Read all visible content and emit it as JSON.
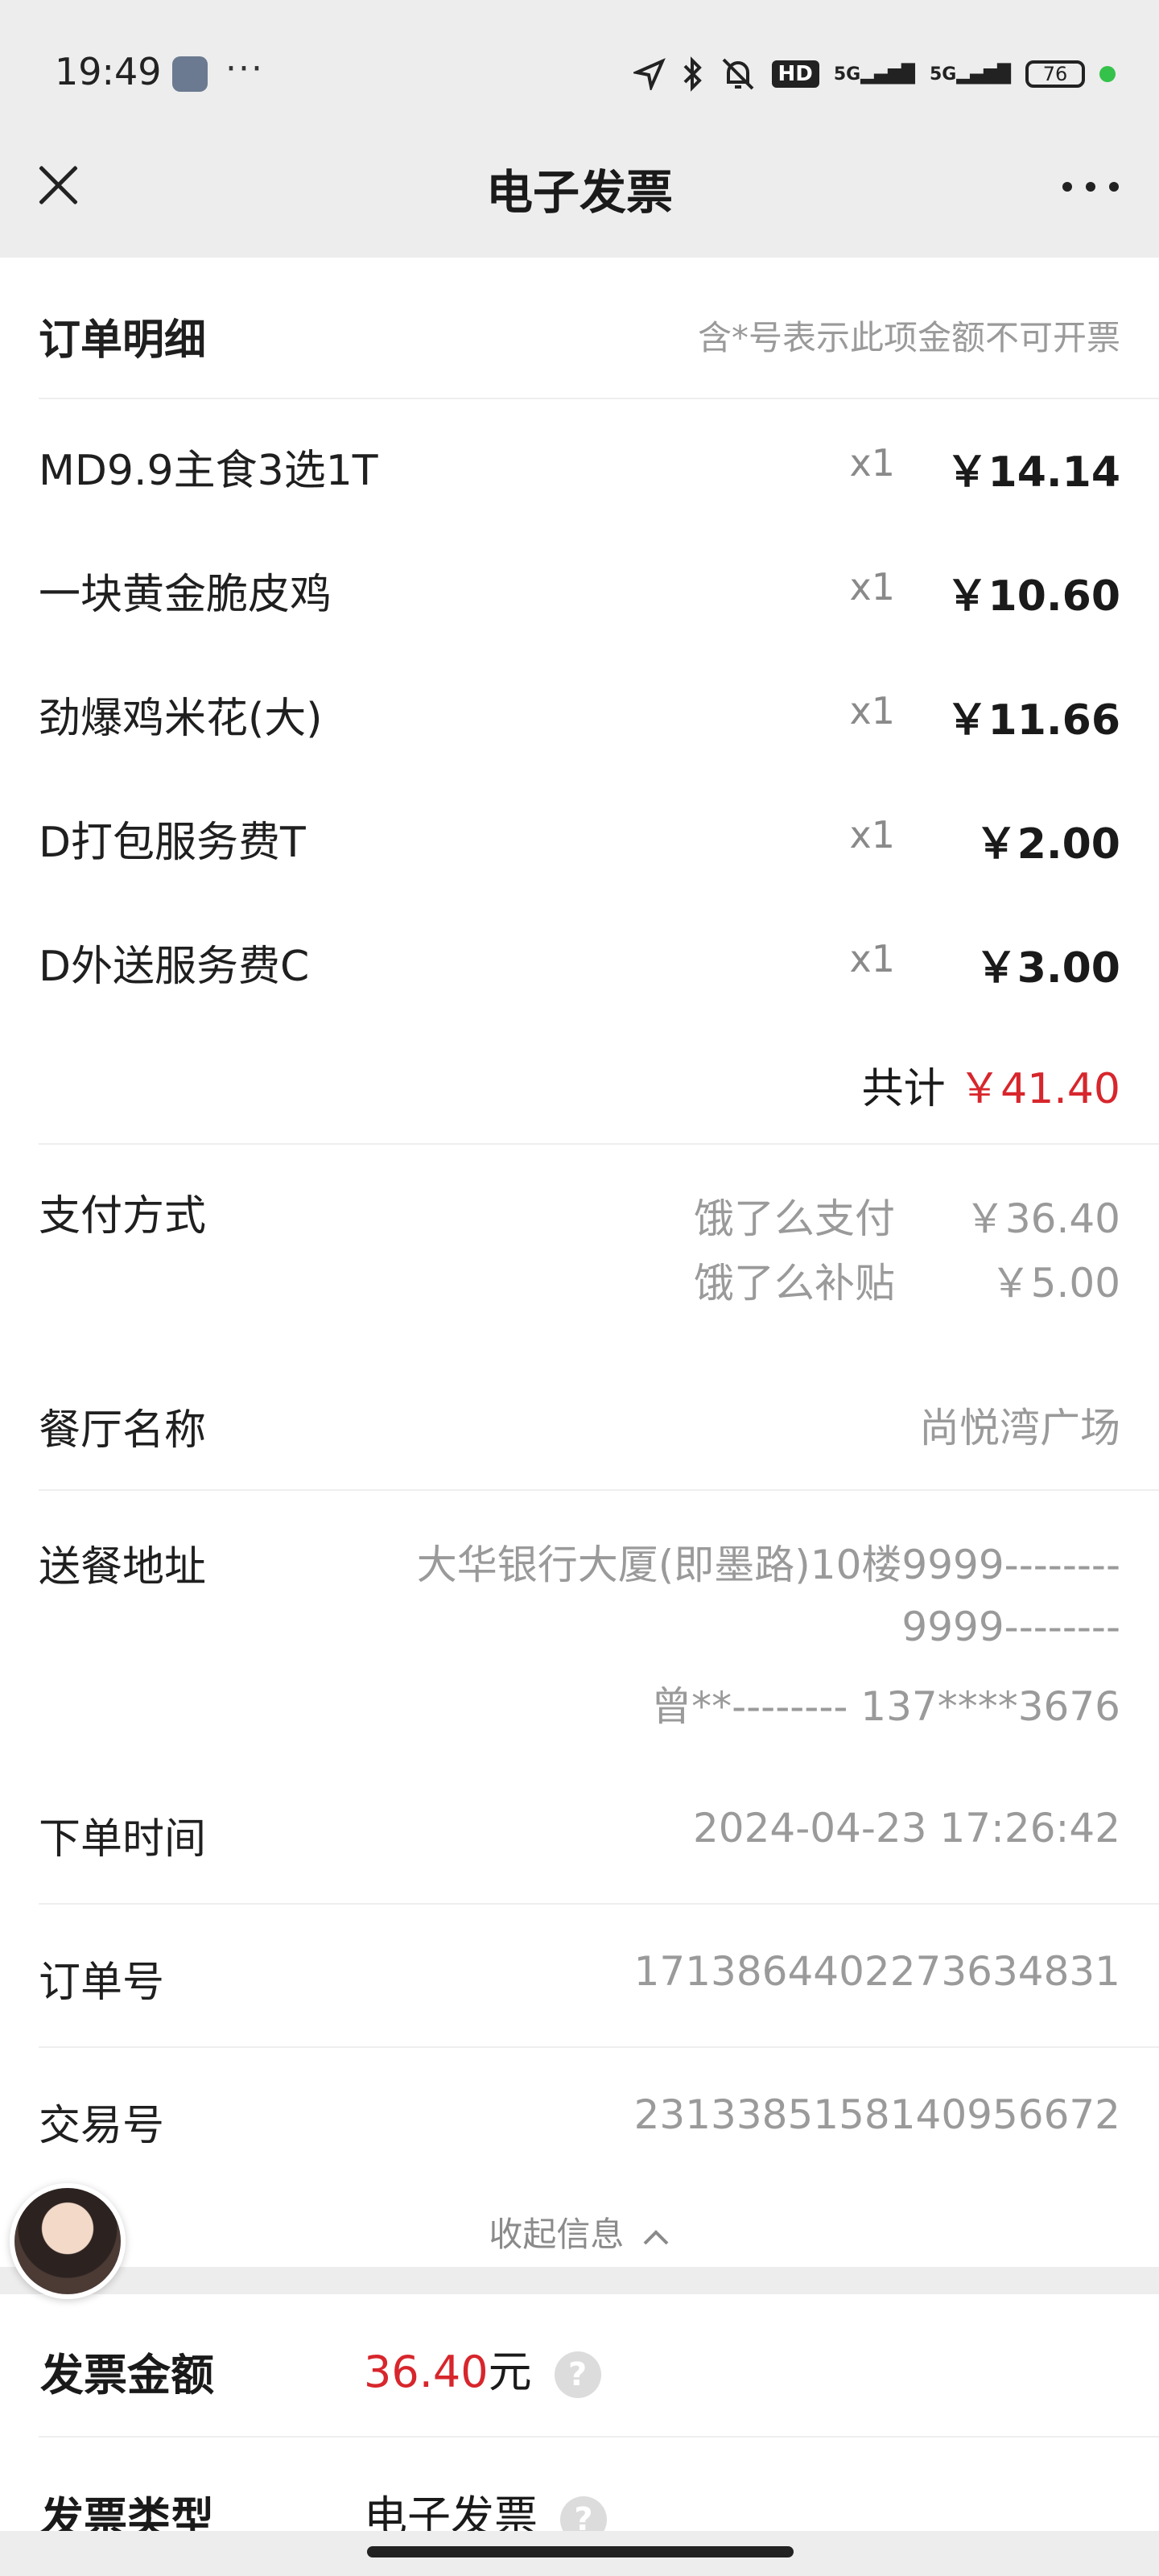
{
  "status_bar": {
    "time": "19:49",
    "hd": "HD",
    "net1": "5G",
    "net2": "5G",
    "battery": "76"
  },
  "nav": {
    "title": "电子发票"
  },
  "order_detail": {
    "heading": "订单明细",
    "note": "含*号表示此项金额不可开票",
    "items": [
      {
        "name": "MD9.9主食3选1T",
        "qty": "x1",
        "price": "￥14.14"
      },
      {
        "name": "一块黄金脆皮鸡",
        "qty": "x1",
        "price": "￥10.60"
      },
      {
        "name": "劲爆鸡米花(大)",
        "qty": "x1",
        "price": "￥11.66"
      },
      {
        "name": "D打包服务费T",
        "qty": "x1",
        "price": "￥2.00"
      },
      {
        "name": "D外送服务费C",
        "qty": "x1",
        "price": "￥3.00"
      }
    ],
    "total_label": "共计",
    "total_value": "￥41.40"
  },
  "payment": {
    "label": "支付方式",
    "methods": [
      {
        "name": "饿了么支付",
        "amount": "￥36.40"
      },
      {
        "name": "饿了么补贴",
        "amount": "￥5.00"
      }
    ]
  },
  "restaurant": {
    "label": "餐厅名称",
    "value": "尚悦湾广场"
  },
  "address": {
    "label": "送餐地址",
    "line1": "大华银行大厦(即墨路)10楼9999--------",
    "line2": "9999--------",
    "line3": "曾**--------  137****3676"
  },
  "order_time": {
    "label": "下单时间",
    "value": "2024-04-23 17:26:42"
  },
  "order_no": {
    "label": "订单号",
    "value": "1713864402273634831"
  },
  "trade_no": {
    "label": "交易号",
    "value": "2313385158140956672"
  },
  "collapse": {
    "label": "收起信息"
  },
  "invoice": {
    "amount_label": "发票金额",
    "amount_value": "36.40",
    "amount_unit": "元",
    "type_label": "发票类型",
    "type_value": "电子发票"
  },
  "colors": {
    "accent_red": "#d7262c",
    "background": "#ededed"
  }
}
